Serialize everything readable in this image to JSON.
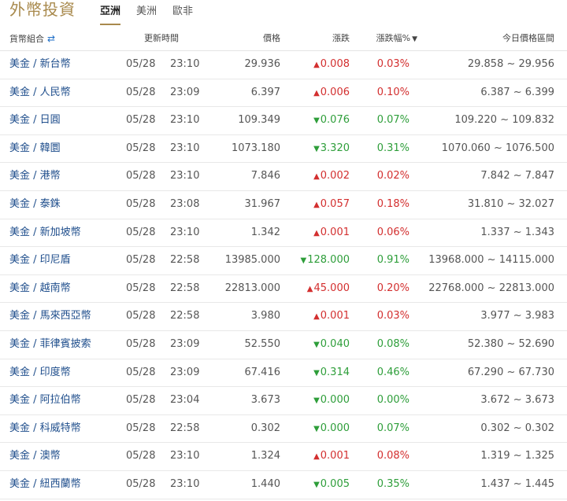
{
  "header": {
    "title": "外幣投資",
    "tabs": [
      {
        "label": "亞洲",
        "active": true
      },
      {
        "label": "美洲",
        "active": false
      },
      {
        "label": "歐非",
        "active": false
      }
    ]
  },
  "table": {
    "columns": {
      "pair": "貨幣組合",
      "updated": "更新時間",
      "price": "價格",
      "change": "漲跌",
      "pct": "漲跌幅%",
      "range": "今日價格區間"
    },
    "icons": {
      "swap": "swap-arrows-icon",
      "sort": "sort-down-icon"
    },
    "colors": {
      "up": "#d32f2f",
      "down": "#2e9e3a",
      "link": "#1f4e8c",
      "accent": "#a8894c"
    },
    "rows": [
      {
        "pair": "美金 / 新台幣",
        "date": "05/28",
        "time": "23:10",
        "price": "29.936",
        "dir": "up",
        "change": "0.008",
        "pct": "0.03%",
        "range": "29.858 ~ 29.956"
      },
      {
        "pair": "美金 / 人民幣",
        "date": "05/28",
        "time": "23:09",
        "price": "6.397",
        "dir": "up",
        "change": "0.006",
        "pct": "0.10%",
        "range": "6.387 ~ 6.399"
      },
      {
        "pair": "美金 / 日圓",
        "date": "05/28",
        "time": "23:10",
        "price": "109.349",
        "dir": "down",
        "change": "0.076",
        "pct": "0.07%",
        "range": "109.220 ~ 109.832"
      },
      {
        "pair": "美金 / 韓圜",
        "date": "05/28",
        "time": "23:10",
        "price": "1073.180",
        "dir": "down",
        "change": "3.320",
        "pct": "0.31%",
        "range": "1070.060 ~ 1076.500"
      },
      {
        "pair": "美金 / 港幣",
        "date": "05/28",
        "time": "23:10",
        "price": "7.846",
        "dir": "up",
        "change": "0.002",
        "pct": "0.02%",
        "range": "7.842 ~ 7.847"
      },
      {
        "pair": "美金 / 泰銖",
        "date": "05/28",
        "time": "23:08",
        "price": "31.967",
        "dir": "up",
        "change": "0.057",
        "pct": "0.18%",
        "range": "31.810 ~ 32.027"
      },
      {
        "pair": "美金 / 新加坡幣",
        "date": "05/28",
        "time": "23:10",
        "price": "1.342",
        "dir": "up",
        "change": "0.001",
        "pct": "0.06%",
        "range": "1.337 ~ 1.343"
      },
      {
        "pair": "美金 / 印尼盾",
        "date": "05/28",
        "time": "22:58",
        "price": "13985.000",
        "dir": "down",
        "change": "128.000",
        "pct": "0.91%",
        "range": "13968.000 ~ 14115.000"
      },
      {
        "pair": "美金 / 越南幣",
        "date": "05/28",
        "time": "22:58",
        "price": "22813.000",
        "dir": "up",
        "change": "45.000",
        "pct": "0.20%",
        "range": "22768.000 ~ 22813.000"
      },
      {
        "pair": "美金 / 馬來西亞幣",
        "date": "05/28",
        "time": "22:58",
        "price": "3.980",
        "dir": "up",
        "change": "0.001",
        "pct": "0.03%",
        "range": "3.977 ~ 3.983"
      },
      {
        "pair": "美金 / 菲律賓披索",
        "date": "05/28",
        "time": "23:09",
        "price": "52.550",
        "dir": "down",
        "change": "0.040",
        "pct": "0.08%",
        "range": "52.380 ~ 52.690"
      },
      {
        "pair": "美金 / 印度幣",
        "date": "05/28",
        "time": "23:09",
        "price": "67.416",
        "dir": "down",
        "change": "0.314",
        "pct": "0.46%",
        "range": "67.290 ~ 67.730"
      },
      {
        "pair": "美金 / 阿拉伯幣",
        "date": "05/28",
        "time": "23:04",
        "price": "3.673",
        "dir": "down",
        "change": "0.000",
        "pct": "0.00%",
        "range": "3.672 ~ 3.673"
      },
      {
        "pair": "美金 / 科威特幣",
        "date": "05/28",
        "time": "22:58",
        "price": "0.302",
        "dir": "down",
        "change": "0.000",
        "pct": "0.07%",
        "range": "0.302 ~ 0.302"
      },
      {
        "pair": "美金 / 澳幣",
        "date": "05/28",
        "time": "23:10",
        "price": "1.324",
        "dir": "up",
        "change": "0.001",
        "pct": "0.08%",
        "range": "1.319 ~ 1.325"
      },
      {
        "pair": "美金 / 紐西蘭幣",
        "date": "05/28",
        "time": "23:10",
        "price": "1.440",
        "dir": "down",
        "change": "0.005",
        "pct": "0.35%",
        "range": "1.437 ~ 1.445"
      }
    ]
  }
}
